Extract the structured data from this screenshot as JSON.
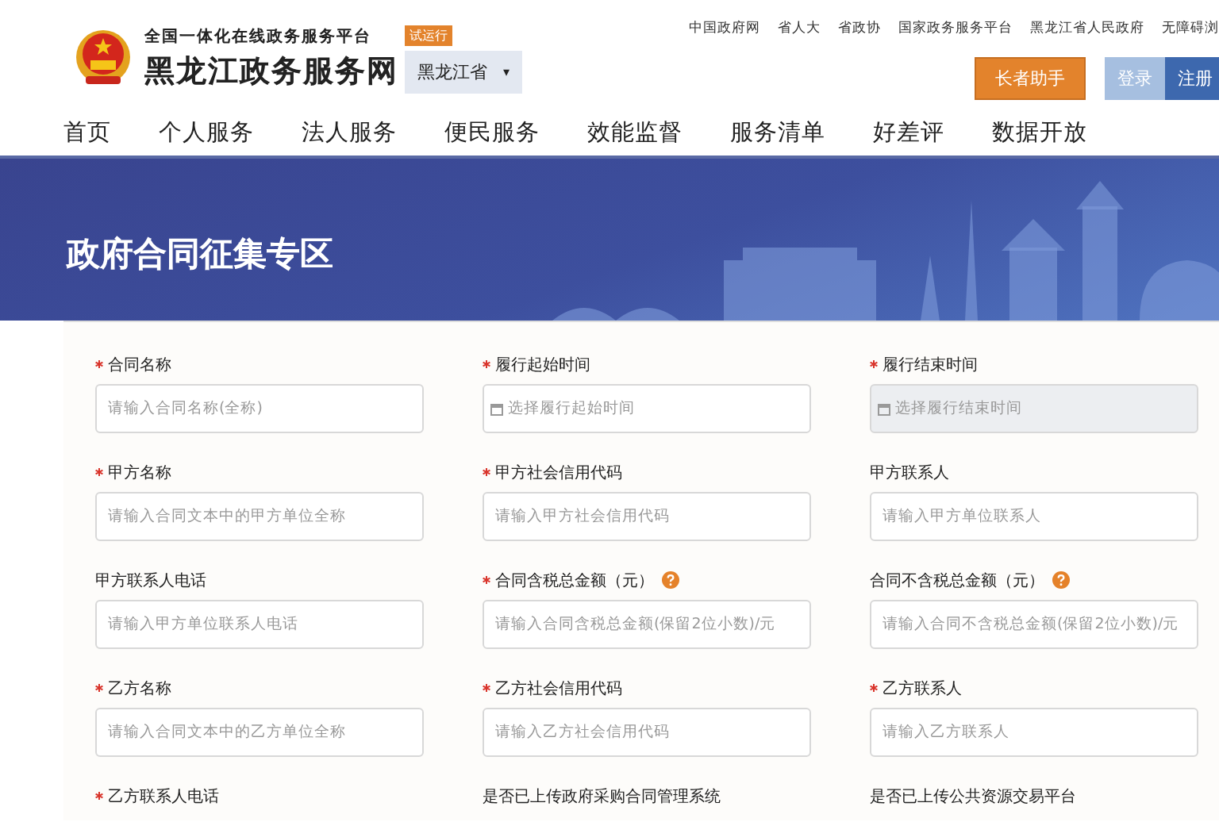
{
  "header": {
    "platform_name": "全国一体化在线政务服务平台",
    "site_name": "黑龙江政务服务网",
    "trial_badge": "试运行",
    "region_selector": {
      "value": "黑龙江省",
      "caret": "▾"
    },
    "top_links": [
      "中国政府网",
      "省人大",
      "省政协",
      "国家政务服务平台",
      "黑龙江省人民政府",
      "无障碍浏"
    ],
    "elder_button": "长者助手",
    "login_button": "登录",
    "register_button": "注册"
  },
  "nav": [
    {
      "label": "首页"
    },
    {
      "label": "个人服务"
    },
    {
      "label": "法人服务"
    },
    {
      "label": "便民服务"
    },
    {
      "label": "效能监督"
    },
    {
      "label": "服务清单"
    },
    {
      "label": "好差评"
    },
    {
      "label": "数据开放"
    }
  ],
  "banner": {
    "title": "政府合同征集专区"
  },
  "form": {
    "fields": [
      {
        "label": "合同名称",
        "required": true,
        "kind": "text",
        "placeholder": "请输入合同名称(全称)",
        "disabled": false,
        "help": false
      },
      {
        "label": "履行起始时间",
        "required": true,
        "kind": "date",
        "placeholder": "选择履行起始时间",
        "disabled": false,
        "help": false
      },
      {
        "label": "履行结束时间",
        "required": true,
        "kind": "date",
        "placeholder": "选择履行结束时间",
        "disabled": true,
        "help": false
      },
      {
        "label": "甲方名称",
        "required": true,
        "kind": "text",
        "placeholder": "请输入合同文本中的甲方单位全称",
        "disabled": false,
        "help": false
      },
      {
        "label": "甲方社会信用代码",
        "required": true,
        "kind": "text",
        "placeholder": "请输入甲方社会信用代码",
        "disabled": false,
        "help": false
      },
      {
        "label": "甲方联系人",
        "required": false,
        "kind": "text",
        "placeholder": "请输入甲方单位联系人",
        "disabled": false,
        "help": false
      },
      {
        "label": "甲方联系人电话",
        "required": false,
        "kind": "text",
        "placeholder": "请输入甲方单位联系人电话",
        "disabled": false,
        "help": false
      },
      {
        "label": "合同含税总金额（元）",
        "required": true,
        "kind": "text",
        "placeholder": "请输入合同含税总金额(保留2位小数)/元",
        "disabled": false,
        "help": true
      },
      {
        "label": "合同不含税总金额（元）",
        "required": false,
        "kind": "text",
        "placeholder": "请输入合同不含税总金额(保留2位小数)/元",
        "disabled": false,
        "help": true
      },
      {
        "label": "乙方名称",
        "required": true,
        "kind": "text",
        "placeholder": "请输入合同文本中的乙方单位全称",
        "disabled": false,
        "help": false
      },
      {
        "label": "乙方社会信用代码",
        "required": true,
        "kind": "text",
        "placeholder": "请输入乙方社会信用代码",
        "disabled": false,
        "help": false
      },
      {
        "label": "乙方联系人",
        "required": true,
        "kind": "text",
        "placeholder": "请输入乙方联系人",
        "disabled": false,
        "help": false
      },
      {
        "label": "乙方联系人电话",
        "required": true,
        "kind": "label_only",
        "disabled": false,
        "help": false
      },
      {
        "label": "是否已上传政府采购合同管理系统",
        "required": false,
        "kind": "label_only",
        "disabled": false,
        "help": false
      },
      {
        "label": "是否已上传公共资源交易平台",
        "required": false,
        "kind": "label_only",
        "disabled": false,
        "help": false
      }
    ]
  }
}
